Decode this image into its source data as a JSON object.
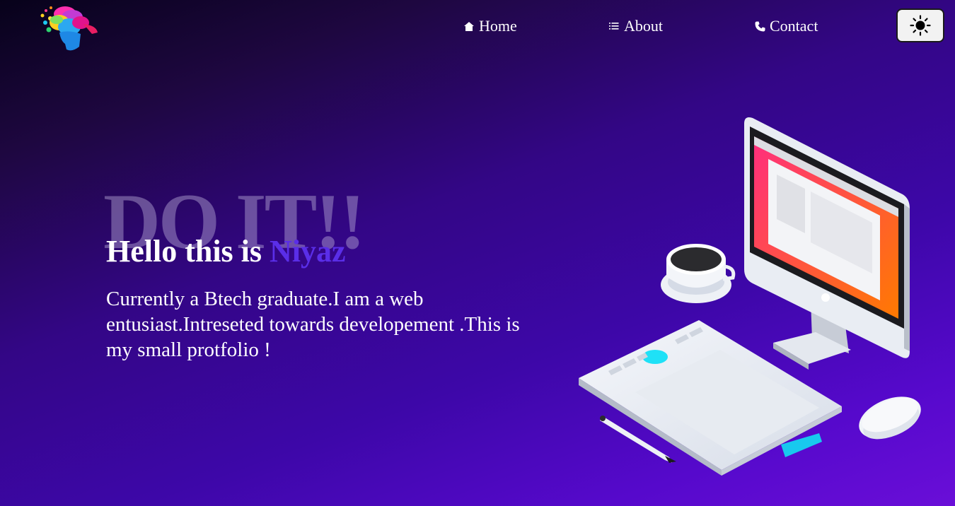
{
  "nav": {
    "logo_icon": "colorful-head-logo",
    "links": [
      {
        "label": "Home",
        "icon": "home-icon"
      },
      {
        "label": "About",
        "icon": "list-icon"
      },
      {
        "label": "Contact",
        "icon": "phone-icon"
      }
    ],
    "theme_toggle_icon": "sun-icon"
  },
  "hero": {
    "background_text": "DO IT!!",
    "greeting": "Hello this is ",
    "name": "Niyaz",
    "description": "Currently a Btech graduate.I am a web entusiast.Intreseted towards developement .This is my small protfolio !"
  },
  "colors": {
    "name_accent": "#5a2ee8",
    "gradient_start": "#07021a",
    "gradient_end": "#6a0ed8"
  }
}
